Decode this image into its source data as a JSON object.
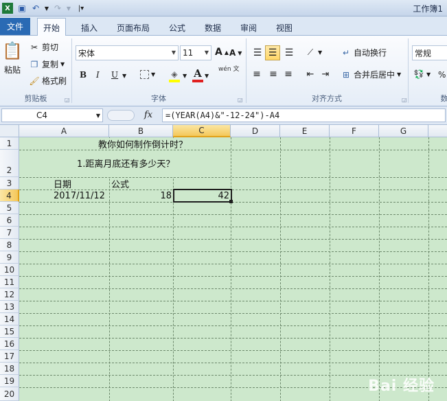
{
  "window": {
    "title": "工作簿1"
  },
  "tabs": [
    {
      "label": "文件"
    },
    {
      "label": "开始",
      "active": true
    },
    {
      "label": "插入"
    },
    {
      "label": "页面布局"
    },
    {
      "label": "公式"
    },
    {
      "label": "数据"
    },
    {
      "label": "审阅"
    },
    {
      "label": "视图"
    }
  ],
  "ribbon": {
    "clipboard": {
      "group_label": "剪贴板",
      "paste": "粘贴",
      "cut": "剪切",
      "copy": "复制",
      "format_painter": "格式刷"
    },
    "font": {
      "group_label": "字体",
      "font_name": "宋体",
      "font_size": "11",
      "grow": "A",
      "shrink": "A",
      "bold": "B",
      "italic": "I",
      "underline": "U",
      "font_color_glyph": "A",
      "wen": "wén\n文"
    },
    "alignment": {
      "group_label": "对齐方式",
      "wrap_text": "自动换行",
      "merge_center": "合并后居中"
    },
    "number": {
      "format": "常规",
      "group_label_partial": "数",
      "percent": "%"
    }
  },
  "formula_bar": {
    "name_box": "C4",
    "fx": "fx",
    "formula": "=(YEAR(A4)&\"-12-24\")-A4"
  },
  "sheet": {
    "columns": [
      "A",
      "B",
      "C",
      "D",
      "E",
      "F",
      "G"
    ],
    "selected_column": "C",
    "rows": [
      "1",
      "2",
      "3",
      "4",
      "5",
      "6",
      "7",
      "8",
      "9",
      "10",
      "11",
      "12",
      "13",
      "14",
      "15",
      "16",
      "17",
      "18",
      "19",
      "20"
    ],
    "selected_row": "4",
    "cells": {
      "title": "教你如何制作倒计时？",
      "subtitle": "1.距离月底还有多少天？",
      "a3": "日期",
      "b3": "公式",
      "a4": "2017/11/12",
      "b4": "18",
      "c4": "42"
    }
  },
  "watermark": "Bai 经验"
}
